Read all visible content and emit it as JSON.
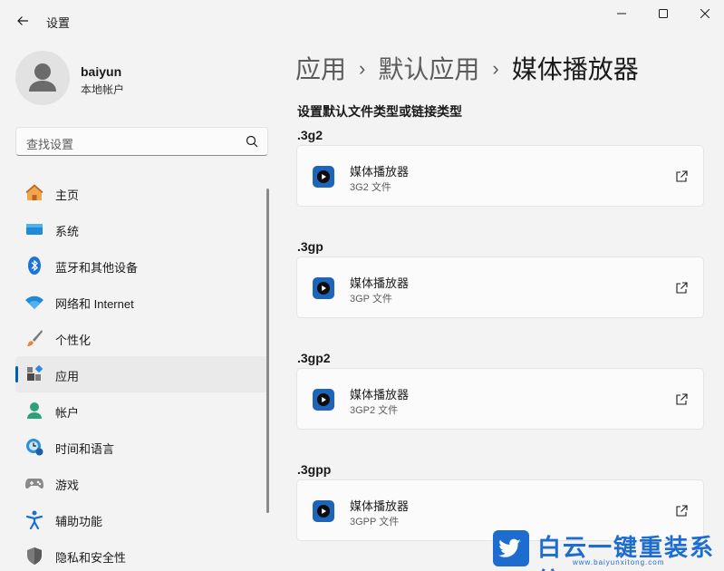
{
  "window": {
    "title": "设置"
  },
  "profile": {
    "name": "baiyun",
    "account_type": "本地帐户"
  },
  "search": {
    "placeholder": "查找设置"
  },
  "nav": [
    {
      "label": "主页",
      "icon": "home-icon"
    },
    {
      "label": "系统",
      "icon": "system-icon"
    },
    {
      "label": "蓝牙和其他设备",
      "icon": "bluetooth-icon"
    },
    {
      "label": "网络和 Internet",
      "icon": "wifi-icon"
    },
    {
      "label": "个性化",
      "icon": "brush-icon"
    },
    {
      "label": "应用",
      "icon": "apps-icon",
      "selected": true
    },
    {
      "label": "帐户",
      "icon": "account-icon"
    },
    {
      "label": "时间和语言",
      "icon": "time-language-icon"
    },
    {
      "label": "游戏",
      "icon": "gamepad-icon"
    },
    {
      "label": "辅助功能",
      "icon": "accessibility-icon"
    },
    {
      "label": "隐私和安全性",
      "icon": "shield-icon"
    }
  ],
  "breadcrumb": {
    "level1": "应用",
    "level2": "默认应用",
    "current": "媒体播放器",
    "separator": "›"
  },
  "main": {
    "section_title": "设置默认文件类型或链接类型",
    "associations": [
      {
        "extension": ".3g2",
        "app": "媒体播放器",
        "description": "3G2 文件"
      },
      {
        "extension": ".3gp",
        "app": "媒体播放器",
        "description": "3GP 文件"
      },
      {
        "extension": ".3gp2",
        "app": "媒体播放器",
        "description": "3GP2 文件"
      },
      {
        "extension": ".3gpp",
        "app": "媒体播放器",
        "description": "3GPP 文件"
      }
    ]
  },
  "watermark": {
    "text": "白云一键重装系统",
    "url": "www.baiyunxitong.com"
  },
  "colors": {
    "accent": "#005fb8",
    "app_icon": "#1e64b8",
    "watermark": "#1d6ccf"
  }
}
